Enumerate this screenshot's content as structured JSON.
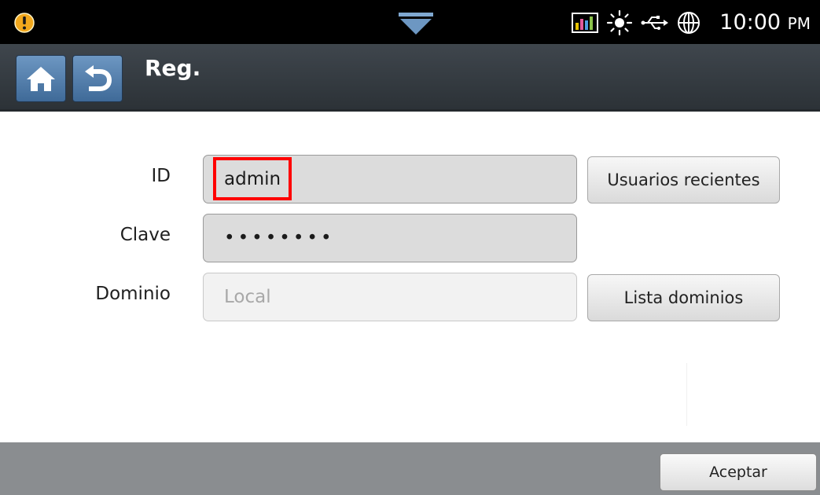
{
  "status_bar": {
    "time": "10:00",
    "ampm": "PM",
    "icons": [
      "warning-icon",
      "notification-drawer-icon",
      "signal-bars-icon",
      "brightness-icon",
      "usb-icon",
      "globe-icon"
    ],
    "colors": {
      "background": "#000000",
      "warning": "#f2a81d",
      "text": "#ffffff"
    }
  },
  "title_bar": {
    "title": "Reg.",
    "home_icon": "home-icon",
    "back_icon": "back-arrow-icon",
    "colors": {
      "button": "#4f7bab"
    }
  },
  "form": {
    "id": {
      "label": "ID",
      "value": "admin",
      "button": "Usuarios recientes"
    },
    "password": {
      "label": "Clave",
      "value": "••••••••"
    },
    "domain": {
      "label": "Dominio",
      "placeholder": "Local",
      "button": "Lista dominios"
    }
  },
  "footer": {
    "ok_label": "Aceptar"
  }
}
